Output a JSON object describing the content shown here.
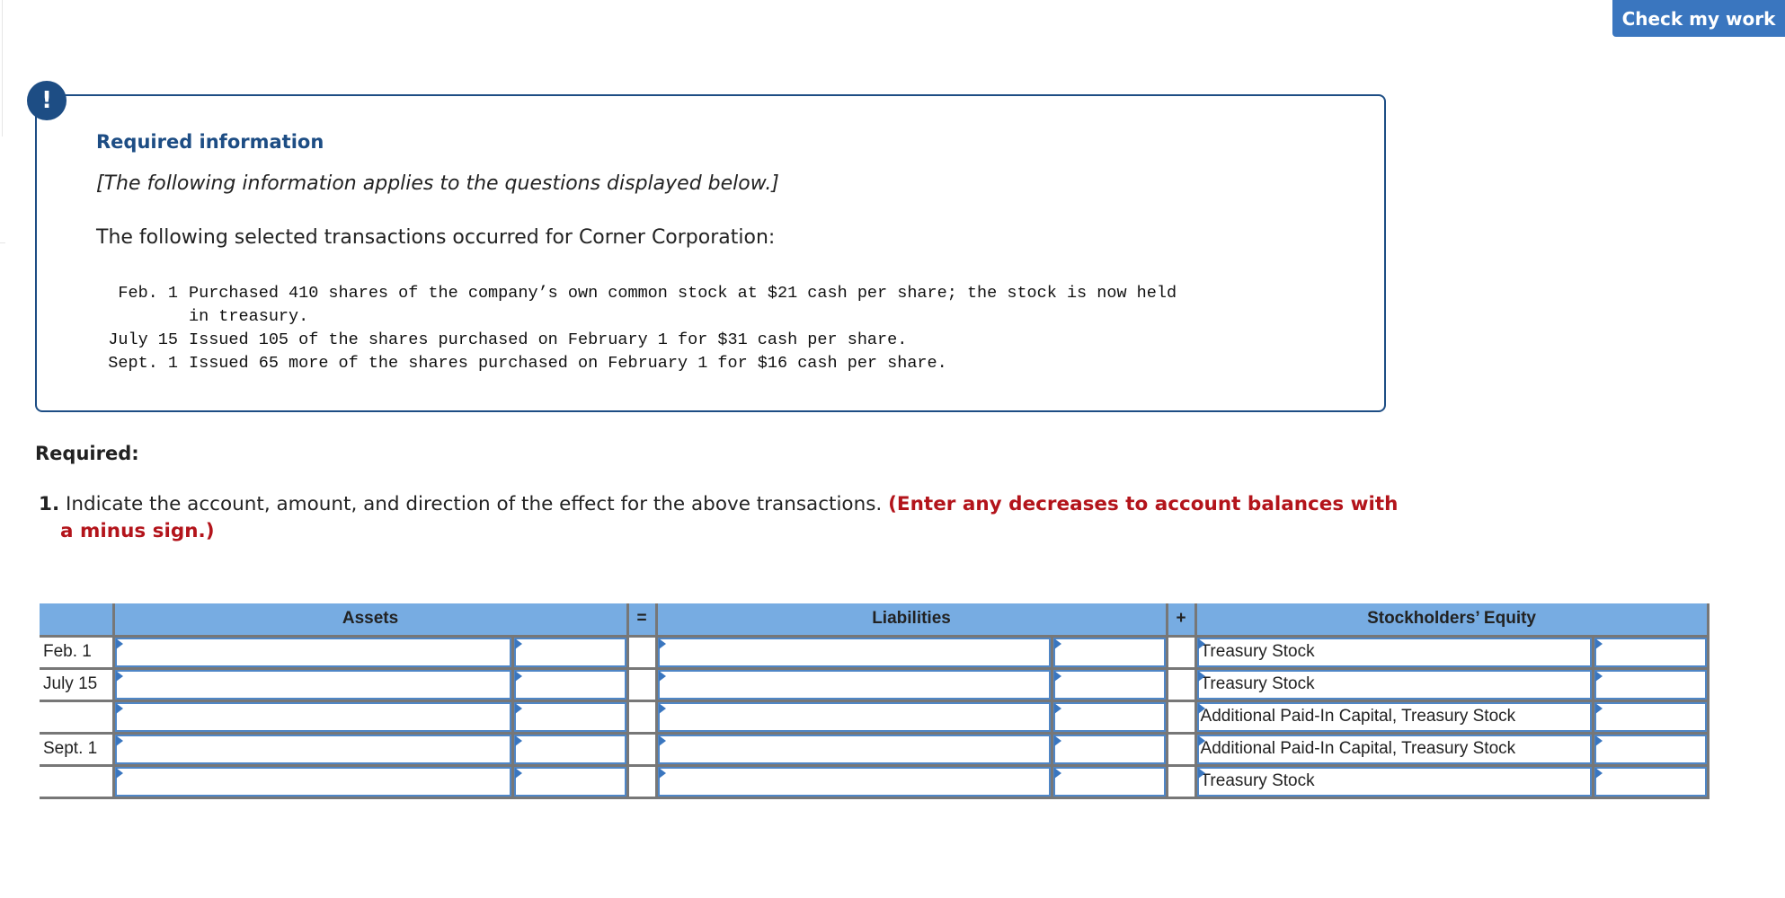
{
  "header": {
    "check_button_label": "Check my work"
  },
  "info_box": {
    "alert_icon_glyph": "!",
    "title": "Required information",
    "note": "[The following information applies to the questions displayed below.]",
    "intro": "The following selected transactions occurred for Corner Corporation:",
    "transactions": [
      {
        "date": "Feb. 1",
        "description": "Purchased 410 shares of the company’s own common stock at $21 cash per share; the stock is now held"
      },
      {
        "date": "",
        "description": "in treasury."
      },
      {
        "date": "July 15",
        "description": "Issued 105 of the shares purchased on February 1 for $31 cash per share."
      },
      {
        "date": "Sept. 1",
        "description": "Issued 65 more of the shares purchased on February 1 for $16 cash per share."
      }
    ]
  },
  "required": {
    "label": "Required:",
    "question_number": "1.",
    "question_text": " Indicate the account, amount, and direction of the effect for the above transactions. ",
    "warning_line1": "(Enter any decreases to account balances with",
    "warning_line2": "a minus sign.)"
  },
  "table": {
    "headers": {
      "assets": "Assets",
      "equals": "=",
      "liabilities": "Liabilities",
      "plus": "+",
      "equity": "Stockholders’ Equity"
    },
    "rows": [
      {
        "date": "Feb. 1",
        "asset_account": "",
        "asset_amount": "",
        "liability_account": "",
        "liability_amount": "",
        "equity_account": "Treasury Stock",
        "equity_amount": ""
      },
      {
        "date": "July 15",
        "asset_account": "",
        "asset_amount": "",
        "liability_account": "",
        "liability_amount": "",
        "equity_account": "Treasury Stock",
        "equity_amount": ""
      },
      {
        "date": "",
        "asset_account": "",
        "asset_amount": "",
        "liability_account": "",
        "liability_amount": "",
        "equity_account": "Additional Paid-In Capital, Treasury Stock",
        "equity_amount": ""
      },
      {
        "date": "Sept. 1",
        "asset_account": "",
        "asset_amount": "",
        "liability_account": "",
        "liability_amount": "",
        "equity_account": "Additional Paid-In Capital, Treasury Stock",
        "equity_amount": ""
      },
      {
        "date": "",
        "asset_account": "",
        "asset_amount": "",
        "liability_account": "",
        "liability_amount": "",
        "equity_account": "Treasury Stock",
        "equity_amount": ""
      }
    ]
  },
  "colors": {
    "brand_blue": "#1d4d84",
    "button_blue": "#3a76bf",
    "header_blue": "#77ace2",
    "warning_red": "#b3141b"
  }
}
